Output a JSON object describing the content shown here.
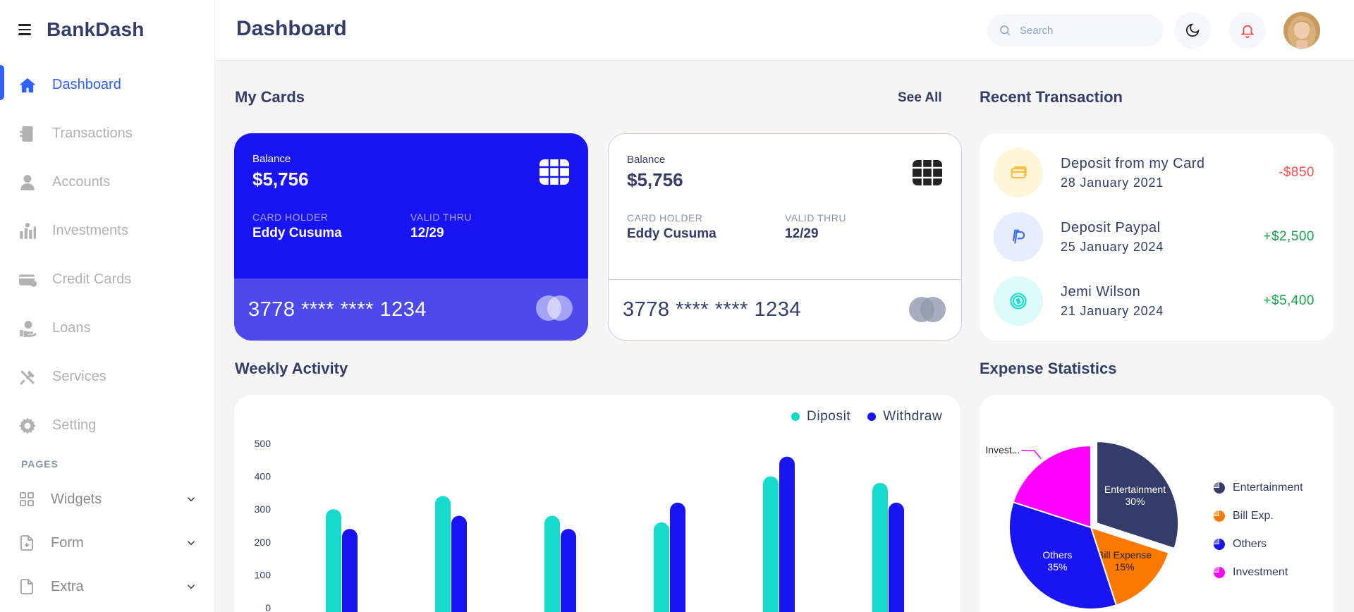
{
  "app": {
    "brand": "BankDash",
    "page_title": "Dashboard"
  },
  "sidebar": {
    "items": [
      {
        "label": "Dashboard",
        "icon": "home-icon",
        "active": true
      },
      {
        "label": "Transactions",
        "icon": "transfer-icon"
      },
      {
        "label": "Accounts",
        "icon": "user-icon"
      },
      {
        "label": "Investments",
        "icon": "investment-icon"
      },
      {
        "label": "Credit Cards",
        "icon": "credit-card-icon"
      },
      {
        "label": "Loans",
        "icon": "loan-icon"
      },
      {
        "label": "Services",
        "icon": "tools-icon"
      },
      {
        "label": "Setting",
        "icon": "gear-icon"
      }
    ],
    "pages_title": "PAGES",
    "pages": [
      {
        "label": "Widgets",
        "icon": "grid-icon"
      },
      {
        "label": "Form",
        "icon": "form-icon"
      },
      {
        "label": "Extra",
        "icon": "file-icon"
      }
    ]
  },
  "header": {
    "search_placeholder": "Search"
  },
  "my_cards": {
    "title": "My Cards",
    "see_all": "See All",
    "cards": [
      {
        "balance_label": "Balance",
        "balance": "$5,756",
        "holder_label": "CARD HOLDER",
        "holder": "Eddy Cusuma",
        "valid_label": "VALID THRU",
        "valid": "12/29",
        "number": "3778 **** **** 1234"
      },
      {
        "balance_label": "Balance",
        "balance": "$5,756",
        "holder_label": "CARD HOLDER",
        "holder": "Eddy Cusuma",
        "valid_label": "VALID THRU",
        "valid": "12/29",
        "number": "3778 **** **** 1234"
      }
    ]
  },
  "recent": {
    "title": "Recent Transaction",
    "items": [
      {
        "title": "Deposit from my Card",
        "date": "28 January 2021",
        "amount": "-$850",
        "icon": "card-icon",
        "kind": "debit"
      },
      {
        "title": "Deposit Paypal",
        "date": "25 January 2024",
        "amount": "+$2,500",
        "icon": "paypal-icon",
        "kind": "credit"
      },
      {
        "title": "Jemi Wilson",
        "date": "21 January 2024",
        "amount": "+$5,400",
        "icon": "dollar-coin-icon",
        "kind": "credit"
      }
    ]
  },
  "weekly": {
    "title": "Weekly Activity",
    "legend": [
      "Diposit",
      "Withdraw"
    ]
  },
  "expense": {
    "title": "Expense Statistics",
    "legend": [
      "Entertainment",
      "Bill Exp.",
      "Others",
      "Investment"
    ]
  },
  "colors": {
    "accent": "#2d60ff",
    "card_blue": "#1814f3",
    "deposit": "#16dbcc",
    "withdraw": "#1814f3",
    "negative": "#ff4b4a",
    "positive": "#16a34a",
    "navy": "#343c6a",
    "orange": "#fc7900",
    "magenta": "#ff00ff"
  },
  "chart_data": [
    {
      "type": "bar",
      "categories": [
        "",
        "",
        "",
        "",
        "",
        ""
      ],
      "series": [
        {
          "name": "Diposit",
          "values": [
            300,
            340,
            280,
            260,
            400,
            380
          ]
        },
        {
          "name": "Withdraw",
          "values": [
            240,
            280,
            240,
            320,
            460,
            320
          ]
        }
      ],
      "ylim": [
        0,
        500
      ],
      "yticks": [
        0,
        100,
        200,
        300,
        400,
        500
      ],
      "legend": "top-right"
    },
    {
      "type": "pie",
      "labels": [
        "Entertainment",
        "Bill Expense",
        "Others",
        "Investment"
      ],
      "values": [
        30,
        15,
        35,
        20
      ],
      "slice_labels": [
        "Entertainment\n30%",
        "Bill Expense\n15%",
        "Others\n35%",
        "Invest..."
      ],
      "legend": "right"
    }
  ]
}
